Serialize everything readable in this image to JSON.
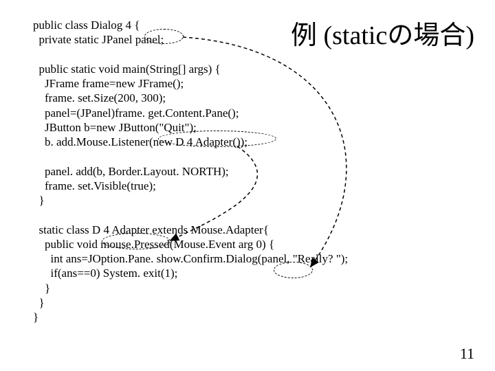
{
  "title": "例 (staticの場合)",
  "code": {
    "l1": "public class Dialog 4 {",
    "l2": "  private static JPanel panel;",
    "l3": "",
    "l4": "  public static void main(String[] args) {",
    "l5": "    JFrame frame=new JFrame();",
    "l6": "    frame. set.Size(200, 300);",
    "l7": "    panel=(JPanel)frame. get.Content.Pane();",
    "l8": "    JButton b=new JButton(\"Quit\");",
    "l9": "    b. add.Mouse.Listener(new D 4 Adapter());",
    "l10": "",
    "l11": "    panel. add(b, Border.Layout. NORTH);",
    "l12": "    frame. set.Visible(true);",
    "l13": "  }",
    "l14": "",
    "l15": "  static class D 4 Adapter extends Mouse.Adapter{",
    "l16": "    public void mouse.Pressed(Mouse.Event arg 0) {",
    "l17": "      int ans=JOption.Pane. show.Confirm.Dialog(panel, \"Really? \");",
    "l18": "      if(ans==0) System. exit(1);",
    "l19": "    }",
    "l20": "  }",
    "l21": "}"
  },
  "pagenum": "11"
}
